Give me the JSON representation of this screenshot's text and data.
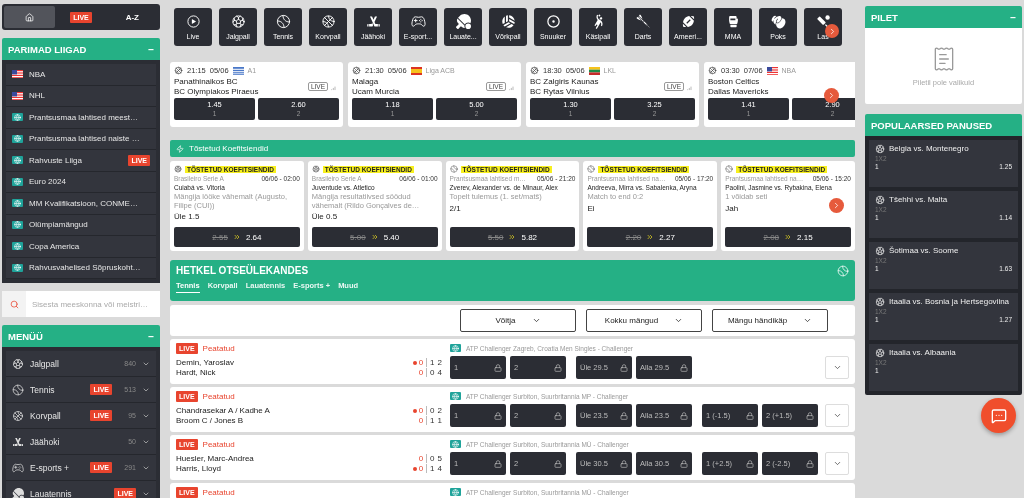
{
  "left_tabs": [
    {
      "kind": "home",
      "selected": true
    },
    {
      "kind": "live",
      "label": "LIVE",
      "selected": false
    },
    {
      "kind": "text",
      "label": "A-Z",
      "selected": false
    }
  ],
  "top_leagues": {
    "title": "PARIMAD LIIGAD",
    "toggle": "−",
    "items": [
      {
        "label": "NBA",
        "kind": "us"
      },
      {
        "label": "NHL",
        "kind": "us"
      },
      {
        "label": "Prantsusmaa lahtised meest…",
        "kind": "globe"
      },
      {
        "label": "Prantsusmaa lahtised naiste …",
        "kind": "globe"
      },
      {
        "label": "Rahvuste Liiga",
        "kind": "globe",
        "badge": "LIVE"
      },
      {
        "label": "Euro 2024",
        "kind": "globe"
      },
      {
        "label": "MM Kvalifikatsioon, CONME…",
        "kind": "globe"
      },
      {
        "label": "Olümpiamängud",
        "kind": "globe"
      },
      {
        "label": "Copa America",
        "kind": "globe"
      },
      {
        "label": "Rahvusvahelised Sõpruskoht…",
        "kind": "globe"
      }
    ]
  },
  "search": {
    "placeholder": "Sisesta meeskonna või meistri…"
  },
  "menu": {
    "title": "MENÜÜ",
    "toggle": "−",
    "items": [
      {
        "kind": "football",
        "label": "Jalgpall",
        "count": "840"
      },
      {
        "kind": "tennis",
        "label": "Tennis",
        "badge": "LIVE",
        "count": "513"
      },
      {
        "kind": "basketball",
        "label": "Korvpall",
        "badge": "LIVE",
        "count": "95"
      },
      {
        "kind": "hockey",
        "label": "Jäähoki",
        "count": "50"
      },
      {
        "kind": "esports",
        "label": "E-sports +",
        "badge": "LIVE",
        "count": "291"
      },
      {
        "kind": "tabletennis",
        "label": "Lauatennis",
        "badge": "LIVE"
      }
    ]
  },
  "sports": [
    {
      "kind": "live",
      "label": "Live"
    },
    {
      "kind": "football",
      "label": "Jalgpall"
    },
    {
      "kind": "tennis",
      "label": "Tennis"
    },
    {
      "kind": "basketball",
      "label": "Korvpall"
    },
    {
      "kind": "hockey",
      "label": "Jäähoki"
    },
    {
      "kind": "esports",
      "label": "E-sport..."
    },
    {
      "kind": "tabletennis",
      "label": "Lauate..."
    },
    {
      "kind": "volleyball",
      "label": "Võrkpall"
    },
    {
      "kind": "snooker",
      "label": "Snuuker"
    },
    {
      "kind": "handball",
      "label": "Käsipall"
    },
    {
      "kind": "darts",
      "label": "Darts"
    },
    {
      "kind": "americanfootball",
      "label": "Ameeri..."
    },
    {
      "kind": "mma",
      "label": "MMA"
    },
    {
      "kind": "boxing",
      "label": "Poks"
    },
    {
      "kind": "cricket",
      "label": "Las"
    }
  ],
  "featured": [
    {
      "time": "21:15",
      "date": "05/06",
      "kind": "gr",
      "league": "A1",
      "home": "Panathinaikos BC",
      "away": "BC Olympiakos Piraeus",
      "live": "LIVE",
      "odds": [
        {
          "value": "1.45",
          "label": "1"
        },
        {
          "value": "2.60",
          "label": "2"
        }
      ]
    },
    {
      "time": "21:30",
      "date": "05/06",
      "kind": "es",
      "league": "Liga ACB",
      "home": "Malaga",
      "away": "Ucam Murcia",
      "live": "LIVE",
      "odds": [
        {
          "value": "1.18",
          "label": "1"
        },
        {
          "value": "5.00",
          "label": "2"
        }
      ]
    },
    {
      "time": "18:30",
      "date": "05/06",
      "kind": "lt",
      "league": "LKL",
      "home": "BC Zalgiris Kaunas",
      "away": "BC Rytas Vilnius",
      "live": "LIVE",
      "odds": [
        {
          "value": "1.30",
          "label": "1"
        },
        {
          "value": "3.25",
          "label": "2"
        }
      ]
    },
    {
      "time": "03:30",
      "date": "07/06",
      "kind": "us",
      "league": "NBA",
      "home": "Boston Celtics",
      "away": "Dallas Mavericks",
      "odds": [
        {
          "value": "1.41",
          "label": "1"
        },
        {
          "value": "2.90",
          "label": "2"
        }
      ]
    }
  ],
  "boosted": {
    "title": "Tõstetud Koefitsiendid",
    "cards": [
      {
        "kind": "football",
        "tag": "TÕSTETUD KOEFITSIENDID",
        "league": "Brasileiro Serie A",
        "when": "06/06 - 02:00",
        "match": "Cuiabá vs. Vitoria",
        "market": "Mängija lööke vähemalt (Augusto, Filipe (CUI))",
        "pick": "Üle 1.5",
        "old": "2.55",
        "new": "2.64"
      },
      {
        "kind": "football",
        "tag": "TÕSTETUD KOEFITSIENDID",
        "league": "Brasileiro Serie A",
        "when": "06/06 - 01:00",
        "match": "Juventude vs. Atletico",
        "market": "Mängija resultatiivsed söödud vähemalt (Rildo Gonçalves de…",
        "pick": "Üle 0.5",
        "old": "5.00",
        "new": "5.40"
      },
      {
        "kind": "tennis",
        "tag": "TÕSTETUD KOEFITSIENDID",
        "league": "Prantsusmaa lahtised m…",
        "when": "05/06 - 21:20",
        "match": "Zverev, Alexander vs. de Minaur, Alex",
        "market": "Topelt tulemus (1. set/matš)",
        "pick": "2/1",
        "old": "5.50",
        "new": "5.82"
      },
      {
        "kind": "tennis",
        "tag": "TÕSTETUD KOEFITSIENDID",
        "league": "Prantsusmaa lahtised na…",
        "when": "05/06 - 17:20",
        "match": "Andreeva, Mirra vs. Sabalenka, Aryna",
        "market": "Match to end 0:2",
        "pick": "Ei",
        "old": "2.20",
        "new": "2.27"
      },
      {
        "kind": "tennis",
        "tag": "TÕSTETUD KOEFITSIENDID",
        "league": "Prantsusmaa lahtised na…",
        "when": "05/06 - 15:20",
        "match": "Paolini, Jasmine vs. Rybakina, Elena",
        "market": "1 võidab seti",
        "pick": "Jah",
        "old": "2.08",
        "new": "2.15"
      }
    ]
  },
  "live": {
    "title": "HETKEL OTSEÜLEKANDES",
    "tabs": [
      {
        "label": "Tennis",
        "selected": true
      },
      {
        "label": "Korvpall",
        "selected": false
      },
      {
        "label": "Lauatennis",
        "selected": false
      },
      {
        "label": "E-sports +",
        "selected": false
      },
      {
        "label": "Muud",
        "selected": false
      }
    ],
    "filters": [
      "Võitja",
      "Kokku mängud",
      "Mängu händikäp"
    ],
    "rows": [
      {
        "badge": "LIVE",
        "status": "Peatatud",
        "league": "ATP Challenger Zagreb, Croatia Men Singles - Challenger",
        "players": [
          {
            "name": "Demin, Yaroslav",
            "serving": true,
            "points": "0",
            "sets": [
              "1",
              "2"
            ]
          },
          {
            "name": "Hardt, Nick",
            "serving": false,
            "points": "0",
            "sets": [
              "0",
              "4"
            ]
          }
        ],
        "odds": [
          [
            {
              "label": "1",
              "locked": true
            },
            {
              "label": "2",
              "locked": true
            }
          ],
          [
            {
              "label": "Üle 29.5",
              "locked": true
            },
            {
              "label": "Alla 29.5",
              "locked": true
            }
          ]
        ]
      },
      {
        "badge": "LIVE",
        "status": "Peatatud",
        "league": "ATP Challenger Surbiton, Suurbritannia MP - Challenger",
        "players": [
          {
            "name": "Chandrasekar A / Kadhe A",
            "serving": true,
            "points": "0",
            "sets": [
              "0",
              "2"
            ]
          },
          {
            "name": "Broom C / Jones B",
            "serving": false,
            "points": "0",
            "sets": [
              "1",
              "1"
            ]
          }
        ],
        "odds": [
          [
            {
              "label": "1",
              "locked": true
            },
            {
              "label": "2",
              "locked": true
            }
          ],
          [
            {
              "label": "Üle 23.5",
              "locked": true
            },
            {
              "label": "Alla 23.5",
              "locked": true
            }
          ],
          [
            {
              "label": "1 (-1.5)",
              "locked": true
            },
            {
              "label": "2 (+1.5)",
              "locked": true
            }
          ]
        ]
      },
      {
        "badge": "LIVE",
        "status": "Peatatud",
        "league": "ATP Challenger Surbiton, Suurbritannia MÜ - Challenger",
        "players": [
          {
            "name": "Huesler, Marc-Andrea",
            "serving": false,
            "points": "0",
            "sets": [
              "0",
              "5"
            ]
          },
          {
            "name": "Harris, Lloyd",
            "serving": true,
            "points": "0",
            "sets": [
              "1",
              "4"
            ]
          }
        ],
        "odds": [
          [
            {
              "label": "1",
              "locked": true
            },
            {
              "label": "2",
              "locked": true
            }
          ],
          [
            {
              "label": "Üle 30.5",
              "locked": true
            },
            {
              "label": "Alla 30.5",
              "locked": true
            }
          ],
          [
            {
              "label": "1 (+2.5)",
              "locked": true
            },
            {
              "label": "2 (-2.5)",
              "locked": true
            }
          ]
        ]
      },
      {
        "badge": "LIVE",
        "status": "Peatatud",
        "league": "ATP Challenger Surbiton, Suurbritannia MÜ - Challenger"
      }
    ]
  },
  "ticket": {
    "title": "PILET",
    "toggle": "−",
    "empty": "Piletil pole valikuid"
  },
  "popular": {
    "title": "POPULAARSED PANUSED",
    "items": [
      {
        "match": "Belgia vs. Montenegro",
        "market": "1X2",
        "pick": "1",
        "odds": "1.25"
      },
      {
        "match": "Tšehhi vs. Malta",
        "market": "1X2",
        "pick": "1",
        "odds": "1.14"
      },
      {
        "match": "Šotimaa vs. Soome",
        "market": "1X2",
        "pick": "1",
        "odds": "1.63"
      },
      {
        "match": "Itaalia vs. Bosnia ja Hertsegoviina",
        "market": "1X2",
        "pick": "1",
        "odds": "1.27"
      },
      {
        "match": "Itaalia vs. Albaania",
        "market": "1X2",
        "pick": "1"
      }
    ]
  }
}
